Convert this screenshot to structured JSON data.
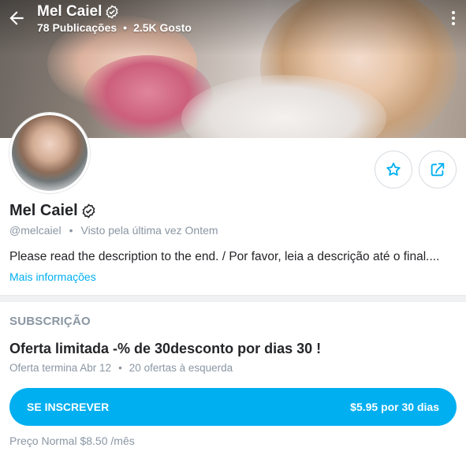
{
  "header": {
    "title": "Mel Caiel",
    "posts": "78 Publicações",
    "likes": "2.5K Gosto",
    "separator": "•"
  },
  "profile": {
    "name": "Mel Caiel",
    "handle": "@melcaiel",
    "separator": "•",
    "last_seen": "Visto pela última vez Ontem",
    "about": "Please read the description to the end. / Por favor, leia a descrição até o final....",
    "more_label": "Mais informações"
  },
  "subscription": {
    "heading": "SUBSCRIÇÃO",
    "offer_title": "Oferta limitada -% de 30desconto por dias 30 !",
    "offer_ends": "Oferta termina Abr 12",
    "separator": "•",
    "offers_left": "20 ofertas à esquerda",
    "button_label": "SE INSCREVER",
    "button_price": "$5.95 por 30 dias",
    "regular_price": "Preço Normal $8.50 /mês"
  },
  "icons": {
    "back": "arrow-left-icon",
    "verified": "verified-badge-icon",
    "menu": "more-vertical-icon",
    "favorite": "star-icon",
    "share": "share-icon"
  },
  "colors": {
    "accent": "#00aff0",
    "muted": "#8a96a3",
    "text": "#242529"
  }
}
